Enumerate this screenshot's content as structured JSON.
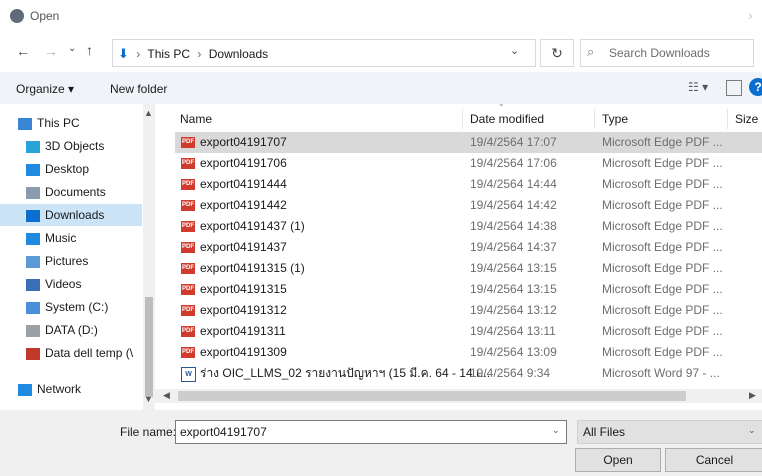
{
  "dialog": {
    "title": "Open"
  },
  "address": {
    "path": [
      "This PC",
      "Downloads"
    ],
    "search_placeholder": "Search Downloads"
  },
  "toolbar": {
    "organize_label": "Organize ▾",
    "new_folder_label": "New folder"
  },
  "nav": {
    "items": [
      {
        "label": "This PC",
        "icon": "pc-icon",
        "color": "#3a86d4"
      },
      {
        "label": "3D Objects",
        "icon": "cube-icon",
        "color": "#29a3d8"
      },
      {
        "label": "Desktop",
        "icon": "desktop-icon",
        "color": "#1f8ae0"
      },
      {
        "label": "Documents",
        "icon": "documents-icon",
        "color": "#8a9bb0"
      },
      {
        "label": "Downloads",
        "icon": "download-icon",
        "color": "#0a6ed1",
        "selected": true
      },
      {
        "label": "Music",
        "icon": "music-icon",
        "color": "#1f8ae0"
      },
      {
        "label": "Pictures",
        "icon": "pictures-icon",
        "color": "#5b9bd5"
      },
      {
        "label": "Videos",
        "icon": "videos-icon",
        "color": "#3a6fb5"
      },
      {
        "label": "System (C:)",
        "icon": "drive-icon",
        "color": "#4a90d9"
      },
      {
        "label": "DATA (D:)",
        "icon": "drive-icon",
        "color": "#9aa0a6"
      },
      {
        "label": "Data dell temp (\\",
        "icon": "network-drive-icon",
        "color": "#c0392b"
      },
      {
        "label": "Network",
        "icon": "network-icon",
        "color": "#1f8ae0"
      }
    ]
  },
  "columns": {
    "name": "Name",
    "date": "Date modified",
    "type": "Type",
    "size": "Size"
  },
  "files": [
    {
      "name": "export04191707",
      "date": "19/4/2564 17:07",
      "type": "Microsoft Edge PDF ...",
      "icon": "pdf",
      "selected": true
    },
    {
      "name": "export04191706",
      "date": "19/4/2564 17:06",
      "type": "Microsoft Edge PDF ...",
      "icon": "pdf"
    },
    {
      "name": "export04191444",
      "date": "19/4/2564 14:44",
      "type": "Microsoft Edge PDF ...",
      "icon": "pdf"
    },
    {
      "name": "export04191442",
      "date": "19/4/2564 14:42",
      "type": "Microsoft Edge PDF ...",
      "icon": "pdf"
    },
    {
      "name": "export04191437 (1)",
      "date": "19/4/2564 14:38",
      "type": "Microsoft Edge PDF ...",
      "icon": "pdf"
    },
    {
      "name": "export04191437",
      "date": "19/4/2564 14:37",
      "type": "Microsoft Edge PDF ...",
      "icon": "pdf"
    },
    {
      "name": "export04191315 (1)",
      "date": "19/4/2564 13:15",
      "type": "Microsoft Edge PDF ...",
      "icon": "pdf"
    },
    {
      "name": "export04191315",
      "date": "19/4/2564 13:15",
      "type": "Microsoft Edge PDF ...",
      "icon": "pdf"
    },
    {
      "name": "export04191312",
      "date": "19/4/2564 13:12",
      "type": "Microsoft Edge PDF ...",
      "icon": "pdf"
    },
    {
      "name": "export04191311",
      "date": "19/4/2564 13:11",
      "type": "Microsoft Edge PDF ...",
      "icon": "pdf"
    },
    {
      "name": "export04191309",
      "date": "19/4/2564 13:09",
      "type": "Microsoft Edge PDF ...",
      "icon": "pdf"
    },
    {
      "name": "ร่าง OIC_LLMS_02 รายงานปัญหาฯ (15 มี.ค. 64 - 14 เ...",
      "date": "19/4/2564 9:34",
      "type": "Microsoft Word 97 - ...",
      "icon": "word"
    }
  ],
  "bottom": {
    "file_name_label": "File name:",
    "file_name_value": "export04191707",
    "filter_value": "All Files",
    "open_label": "Open",
    "cancel_label": "Cancel"
  }
}
